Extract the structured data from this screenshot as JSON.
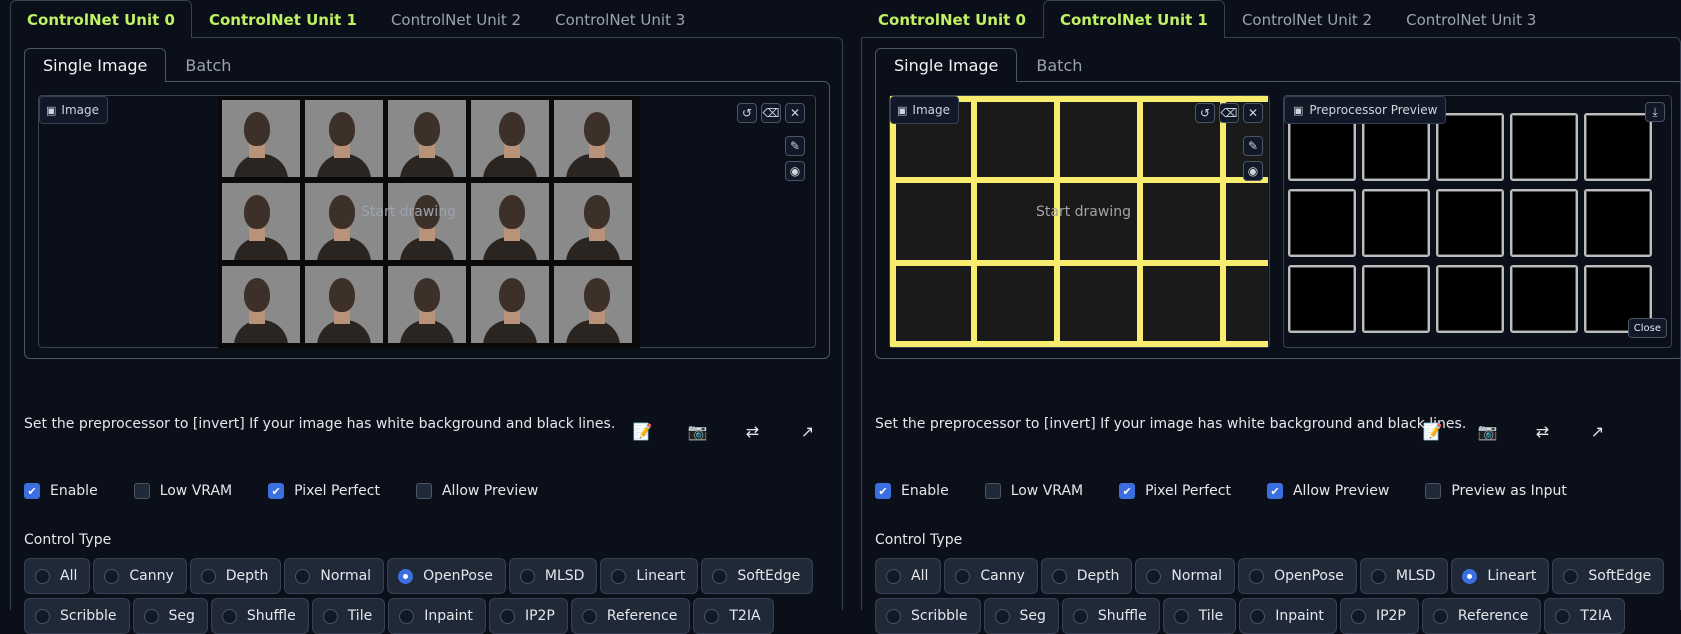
{
  "colors": {
    "background": "#0b0f19",
    "enabled_tab": "#bef264",
    "accent": "#3b6fe0",
    "lineart": "#f7ec6e"
  },
  "left": {
    "unit_tabs": [
      {
        "label": "ControlNet Unit 0",
        "enabled": true,
        "selected": true
      },
      {
        "label": "ControlNet Unit 1",
        "enabled": true,
        "selected": false
      },
      {
        "label": "ControlNet Unit 2",
        "enabled": false,
        "selected": false
      },
      {
        "label": "ControlNet Unit 3",
        "enabled": false,
        "selected": false
      }
    ],
    "sub_tabs": [
      {
        "label": "Single Image",
        "selected": true
      },
      {
        "label": "Batch",
        "selected": false
      }
    ],
    "image_label": "Image",
    "start_drawing": "Start drawing",
    "hint": "Set the preprocessor to [invert] If your image has white background and black lines.",
    "checkboxes": [
      {
        "label": "Enable",
        "checked": true
      },
      {
        "label": "Low VRAM",
        "checked": false
      },
      {
        "label": "Pixel Perfect",
        "checked": true
      },
      {
        "label": "Allow Preview",
        "checked": false
      }
    ],
    "control_type_label": "Control Type",
    "control_types_row1": [
      {
        "label": "All",
        "selected": false
      },
      {
        "label": "Canny",
        "selected": false
      },
      {
        "label": "Depth",
        "selected": false
      },
      {
        "label": "Normal",
        "selected": false
      },
      {
        "label": "OpenPose",
        "selected": true
      },
      {
        "label": "MLSD",
        "selected": false
      },
      {
        "label": "Lineart",
        "selected": false
      },
      {
        "label": "SoftEdge",
        "selected": false
      }
    ],
    "control_types_row2": [
      {
        "label": "Scribble",
        "selected": false
      },
      {
        "label": "Seg",
        "selected": false
      },
      {
        "label": "Shuffle",
        "selected": false
      },
      {
        "label": "Tile",
        "selected": false
      },
      {
        "label": "Inpaint",
        "selected": false
      },
      {
        "label": "IP2P",
        "selected": false
      },
      {
        "label": "Reference",
        "selected": false
      },
      {
        "label": "T2IA",
        "selected": false
      }
    ]
  },
  "right": {
    "unit_tabs": [
      {
        "label": "ControlNet Unit 0",
        "enabled": true,
        "selected": false
      },
      {
        "label": "ControlNet Unit 1",
        "enabled": true,
        "selected": true
      },
      {
        "label": "ControlNet Unit 2",
        "enabled": false,
        "selected": false
      },
      {
        "label": "ControlNet Unit 3",
        "enabled": false,
        "selected": false
      }
    ],
    "sub_tabs": [
      {
        "label": "Single Image",
        "selected": true
      },
      {
        "label": "Batch",
        "selected": false
      }
    ],
    "image_label": "Image",
    "start_drawing": "Start drawing",
    "preview_label": "Preprocessor Preview",
    "close_label": "Close",
    "hint": "Set the preprocessor to [invert] If your image has white background and black lines.",
    "checkboxes": [
      {
        "label": "Enable",
        "checked": true
      },
      {
        "label": "Low VRAM",
        "checked": false
      },
      {
        "label": "Pixel Perfect",
        "checked": true
      },
      {
        "label": "Allow Preview",
        "checked": true
      },
      {
        "label": "Preview as Input",
        "checked": false
      }
    ],
    "control_type_label": "Control Type",
    "control_types_row1": [
      {
        "label": "All",
        "selected": false
      },
      {
        "label": "Canny",
        "selected": false
      },
      {
        "label": "Depth",
        "selected": false
      },
      {
        "label": "Normal",
        "selected": false
      },
      {
        "label": "OpenPose",
        "selected": false
      },
      {
        "label": "MLSD",
        "selected": false
      },
      {
        "label": "Lineart",
        "selected": true
      },
      {
        "label": "SoftEdge",
        "selected": false
      }
    ],
    "control_types_row2": [
      {
        "label": "Scribble",
        "selected": false
      },
      {
        "label": "Seg",
        "selected": false
      },
      {
        "label": "Shuffle",
        "selected": false
      },
      {
        "label": "Tile",
        "selected": false
      },
      {
        "label": "Inpaint",
        "selected": false
      },
      {
        "label": "IP2P",
        "selected": false
      },
      {
        "label": "Reference",
        "selected": false
      },
      {
        "label": "T2IA",
        "selected": false
      }
    ]
  },
  "icons": {
    "image": "image-icon",
    "undo": "undo-icon",
    "eraser": "eraser-icon",
    "clear": "close-icon",
    "brush": "brush-icon",
    "palette": "palette-icon",
    "download": "download-icon",
    "edit": "edit-icon",
    "camera": "camera-icon",
    "swap": "swap-icon",
    "send": "send-icon"
  }
}
